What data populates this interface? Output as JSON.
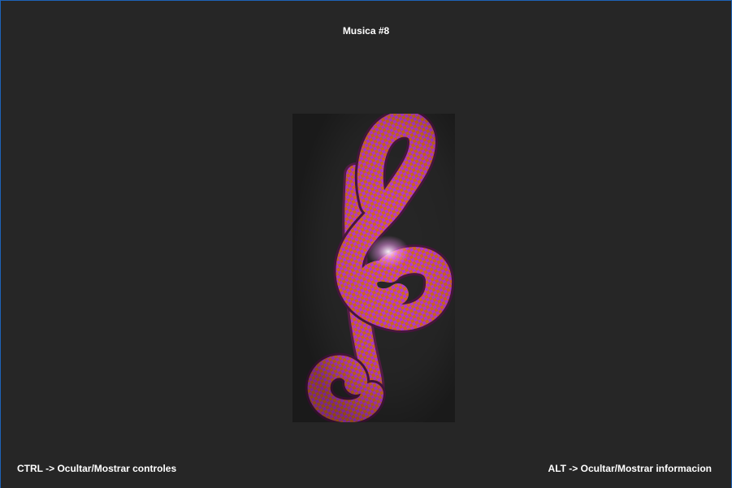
{
  "window": {
    "title": "Musica #8"
  },
  "scene": {
    "object": "treble-clef-3d",
    "texture": "checkerboard",
    "colors": {
      "background": "#262626",
      "check_a": "#c13bd6",
      "check_b": "#d2691e",
      "highlight": "#ffffff"
    }
  },
  "hints": {
    "controls": "CTRL -> Ocultar/Mostrar controles",
    "info": "ALT -> Ocultar/Mostrar informacion"
  }
}
